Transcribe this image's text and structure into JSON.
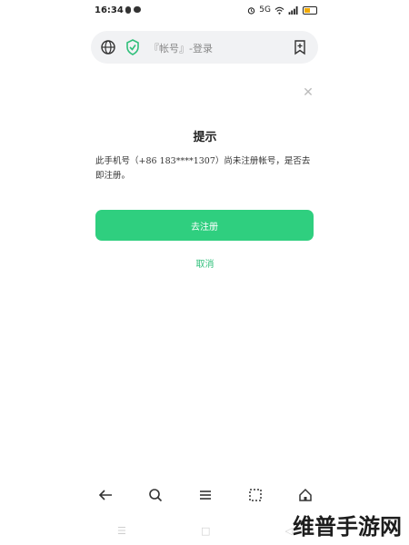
{
  "status_bar": {
    "time": "16:34",
    "right_icons": [
      "alarm-icon",
      "data-icon",
      "wifi-icon",
      "signal-icon",
      "battery-icon"
    ],
    "data_label": "5G",
    "battery_color": "#f2a900"
  },
  "browser": {
    "url_text": "『帐号』-登录",
    "shield_color": "#2fbf7a"
  },
  "dialog": {
    "title": "提示",
    "message": "此手机号（+86 183****1307）尚未注册帐号，是否去即注册。",
    "primary_button": "去注册",
    "cancel": "取消",
    "accent_color": "#2fcf7f"
  },
  "toolbar": {
    "icons": [
      "back-icon",
      "search-icon",
      "menu-icon",
      "tabs-icon",
      "home-icon"
    ]
  },
  "system_nav": {
    "icons": [
      "recent-apps-icon",
      "home-nav-icon",
      "back-nav-icon"
    ],
    "recent": "☰",
    "home": "□",
    "back": "◁"
  },
  "watermark": "维普手游网"
}
